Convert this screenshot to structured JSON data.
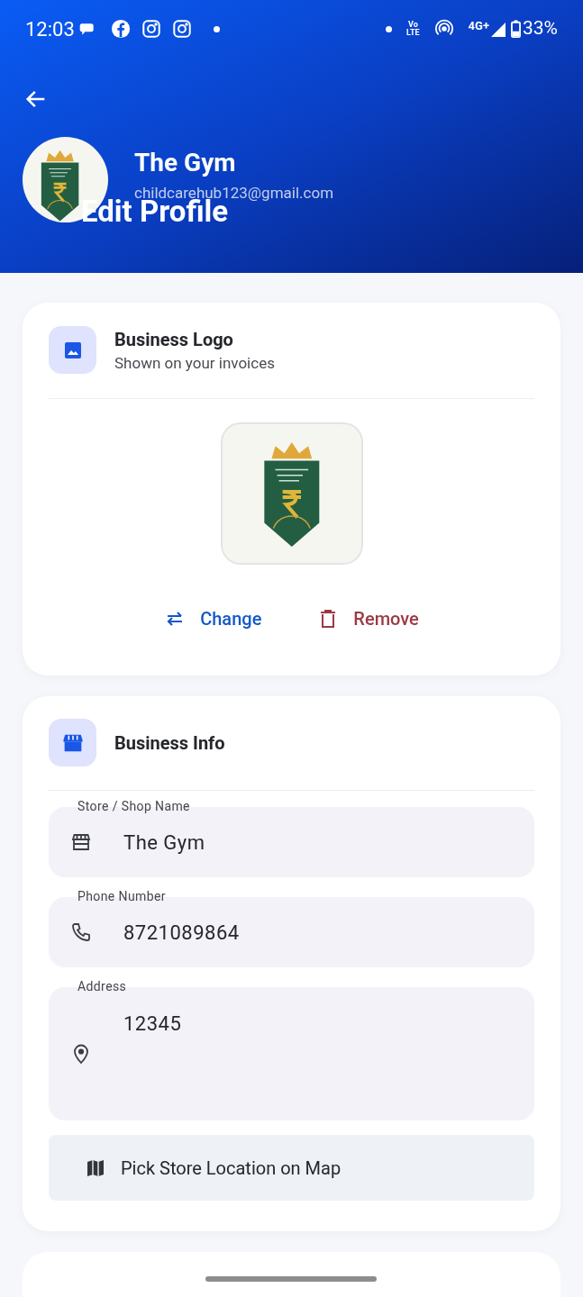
{
  "status_bar": {
    "time": "12:03",
    "volte_top": "Vo",
    "volte_bottom": "LTE",
    "network": "4G+",
    "battery": "33%"
  },
  "header": {
    "name": "The Gym",
    "email": "childcarehub123@gmail.com",
    "title": "Edit Profile"
  },
  "logo_card": {
    "title": "Business Logo",
    "subtitle": "Shown on your invoices",
    "actions": [
      {
        "kind": "change",
        "label": "Change"
      },
      {
        "kind": "remove",
        "label": "Remove"
      }
    ]
  },
  "info_card": {
    "title": "Business Info",
    "fields": [
      {
        "kind": "store",
        "label": "Store / Shop Name",
        "value": "The Gym"
      },
      {
        "kind": "phone",
        "label": "Phone Number",
        "value": "8721089864"
      },
      {
        "kind": "address",
        "label": "Address",
        "value": "12345"
      }
    ],
    "map_button": "Pick Store Location on Map"
  }
}
